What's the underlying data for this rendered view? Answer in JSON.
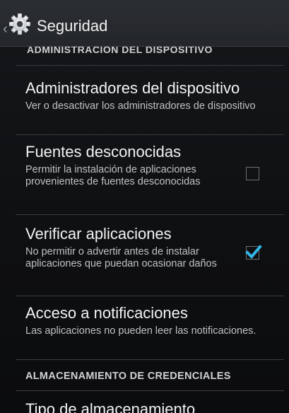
{
  "actionbar": {
    "title": "Seguridad",
    "icon": "gear-icon",
    "up_icon": "chevron-left-icon"
  },
  "partial_section_header": "ADMINISTRACIÓN DEL DISPOSITIVO",
  "items": [
    {
      "title": "Administradores del dispositivo",
      "summary": "Ver o desactivar los administradores de dispositivo"
    },
    {
      "title": "Fuentes desconocidas",
      "summary": "Permitir la instalación de aplicaciones provenientes de fuentes desconocidas",
      "checked": false
    },
    {
      "title": "Verificar aplicaciones",
      "summary": "No permitir o advertir antes de instalar aplicaciones que puedan ocasionar daños",
      "checked": true
    },
    {
      "title": "Acceso a notificaciones",
      "summary": "Las aplicaciones no pueden leer las notificaciones."
    }
  ],
  "section_header": "ALMACENAMIENTO DE CREDENCIALES",
  "partial_item": "Tipo de almacenamiento",
  "colors": {
    "accent": "#33b5e5",
    "background": "#0e0f11",
    "actionbar": "#2b2e33"
  }
}
